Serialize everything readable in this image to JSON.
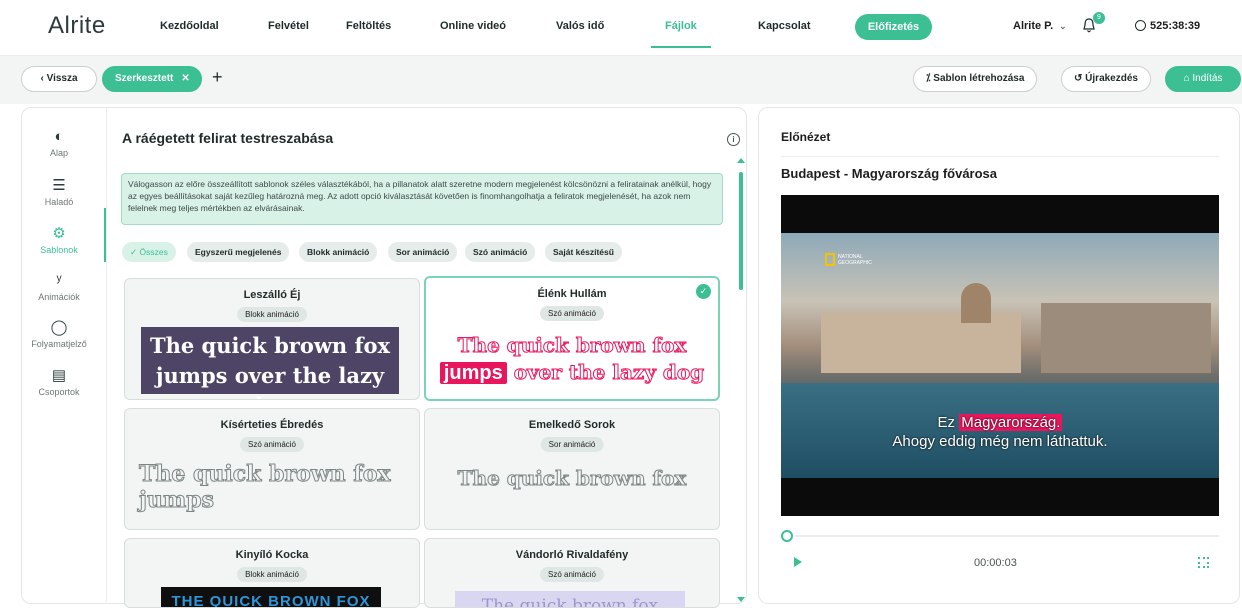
{
  "app": {
    "logo": "Alrite"
  },
  "nav": {
    "items": [
      "Kezdőoldal",
      "Felvétel",
      "Feltöltés",
      "Online videó",
      "Valós idő",
      "Fájlok",
      "Kapcsolat"
    ],
    "subscribe": "Előfizetés",
    "user": "Alrite P.",
    "notifications": "9",
    "timer": "525:38:39"
  },
  "toolbar": {
    "back": "‹  Vissza",
    "tag": "Szerkesztett",
    "tag_close": "✕",
    "add": "+",
    "template_btn": "Sablon létrehozása",
    "restart_btn": "Újrakezdés",
    "start_btn": "Indítás"
  },
  "sidebar": {
    "items": [
      {
        "label": "Alap",
        "icon": "palette-icon"
      },
      {
        "label": "Haladó",
        "icon": "sliders-icon"
      },
      {
        "label": "Sablonok",
        "icon": "gear-icon"
      },
      {
        "label": "Animációk",
        "icon": "motion-icon"
      },
      {
        "label": "Folyamatjelző",
        "icon": "progress-icon"
      },
      {
        "label": "Csoportok",
        "icon": "groups-icon"
      }
    ]
  },
  "panel": {
    "title": "A ráégetett felirat testreszabása",
    "info": "i",
    "description": "Válogasson az előre összeállított sablonok széles választékából, ha a pillanatok alatt szeretne modern megjelenést kölcsönözni a feliratainak anélkül, hogy az egyes beállításokat saját kezűleg határozná meg. Az adott opció kiválasztását követően is finomhangolhatja a feliratok megjelenését, ha azok nem felelnek meg teljes mértékben az elvárásainak.",
    "filters": [
      "Összes",
      "Egyszerű megjelenés",
      "Blokk animáció",
      "Sor animáció",
      "Szó animáció",
      "Saját készítésű"
    ],
    "filter_check": "✓"
  },
  "cards": [
    {
      "name": "Leszálló Éj",
      "badge": "Blokk animáció",
      "preview": "The quick brown fox jumps over the lazy dog"
    },
    {
      "name": "Élénk Hullám",
      "badge": "Szó animáció",
      "preview_a": "The quick brown fox",
      "preview_hl": "jumps",
      "preview_b": "over the lazy dog",
      "check": "✓"
    },
    {
      "name": "Kísérteties Ébredés",
      "badge": "Szó animáció",
      "preview": "The quick brown fox jumps"
    },
    {
      "name": "Emelkedő Sorok",
      "badge": "Sor animáció",
      "preview": "The quick brown fox"
    },
    {
      "name": "Kinyíló Kocka",
      "badge": "Blokk animáció",
      "preview": "THE QUICK BROWN FOX"
    },
    {
      "name": "Vándorló Rivaldafény",
      "badge": "Szó animáció",
      "preview": "The quick brown fox"
    }
  ],
  "preview": {
    "label": "Előnézet",
    "video_title": "Budapest - Magyarország fővárosa",
    "watermark_line1": "NATIONAL",
    "watermark_line2": "GEOGRAPHIC",
    "subtitle_a": "Ez",
    "subtitle_hl": "Magyarország.",
    "subtitle_line2": "Ahogy eddig még nem láthattuk.",
    "time": "00:00:03"
  },
  "colors": {
    "accent": "#3bbf93",
    "highlight": "#e8175d",
    "card_dark": "#4e4566"
  }
}
